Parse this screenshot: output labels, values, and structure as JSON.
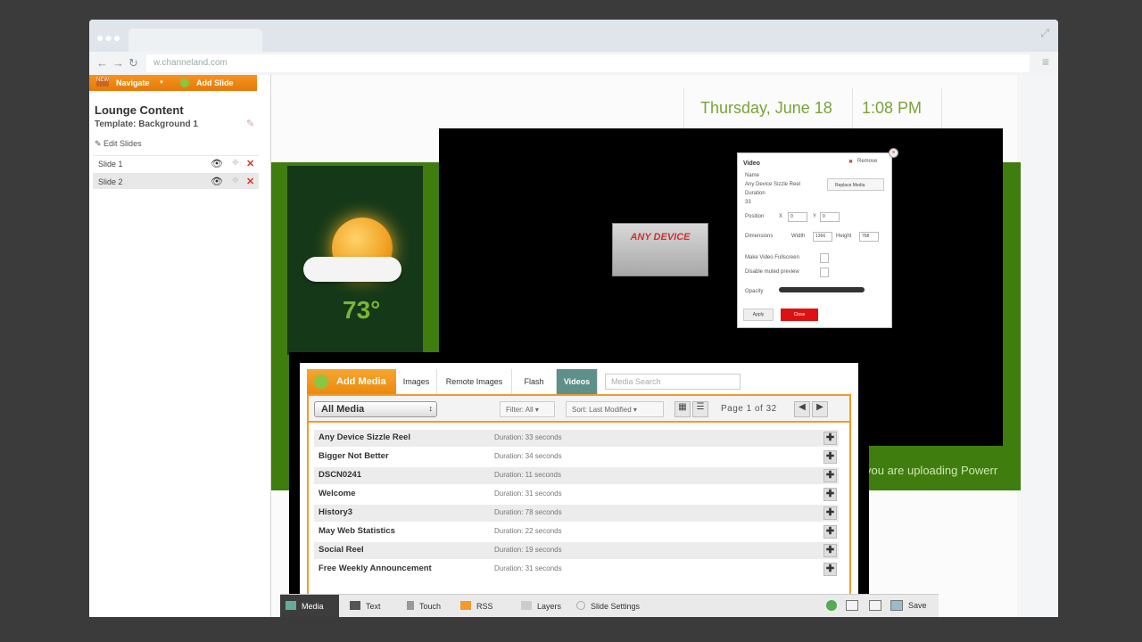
{
  "browser": {
    "url": "w.channeland.com"
  },
  "sidebar": {
    "navigate_label": "Navigate",
    "add_slide_label": "Add Slide",
    "new_badge": "NEW",
    "title": "Lounge Content",
    "template": "Template: Background 1",
    "edit_slides": "Edit Slides",
    "slides": [
      {
        "label": "Slide 1"
      },
      {
        "label": "Slide 2"
      }
    ]
  },
  "header": {
    "date": "Thursday, June 18",
    "time": "1:08 PM"
  },
  "weather": {
    "temperature": "73°"
  },
  "ticker": {
    "text": "you are uploading Powerr"
  },
  "video_preview": {
    "title": "ANY DEVICE"
  },
  "video_dialog": {
    "title": "Video",
    "remove": "Remove",
    "name_label": "Name",
    "name_value": "Any Device Sizzle Reel",
    "duration_label": "Duration",
    "duration_value": "33",
    "replace_label": "Replace Media",
    "position_label": "Position",
    "x_label": "X",
    "x_value": "0",
    "y_label": "Y",
    "y_value": "0",
    "dimensions_label": "Dimensions",
    "width_label": "Width",
    "width_value": "1366",
    "height_label": "Height",
    "height_value": "768",
    "make_video_label": "Make Video Fullscreen",
    "disable_label": "Disable muted preview",
    "opacity_label": "Opacity",
    "apply_label": "Apply",
    "close_label": "Close"
  },
  "media": {
    "add_media": "Add Media",
    "tabs": [
      {
        "label": "Images"
      },
      {
        "label": "Remote Images"
      },
      {
        "label": "Flash"
      },
      {
        "label": "Videos"
      }
    ],
    "search_placeholder": "Media Search",
    "select_value": "All Media",
    "filter": "Filter: All ▾",
    "sort": "Sort: Last Modified ▾",
    "page_info": "Page 1 of 32",
    "rows": [
      {
        "name": "Any Device Sizzle Reel",
        "duration": "Duration: 33 seconds"
      },
      {
        "name": "Bigger Not Better",
        "duration": "Duration: 34 seconds"
      },
      {
        "name": "DSCN0241",
        "duration": "Duration: 11 seconds"
      },
      {
        "name": "Welcome",
        "duration": "Duration: 31 seconds"
      },
      {
        "name": "History3",
        "duration": "Duration: 78 seconds"
      },
      {
        "name": "May Web Statistics",
        "duration": "Duration: 22 seconds"
      },
      {
        "name": "Social Reel",
        "duration": "Duration: 19 seconds"
      },
      {
        "name": "Free Weekly Announcement",
        "duration": "Duration: 31 seconds"
      }
    ]
  },
  "toolbar": {
    "media": "Media",
    "text": "Text",
    "touch": "Touch",
    "rss": "RSS",
    "layers": "Layers",
    "slide_settings": "Slide Settings",
    "save": "Save"
  },
  "colors": {
    "accent": "#f7941d",
    "green": "#3f7d0f",
    "temp": "#7ab53a",
    "active_tab": "#5f8f8a"
  }
}
